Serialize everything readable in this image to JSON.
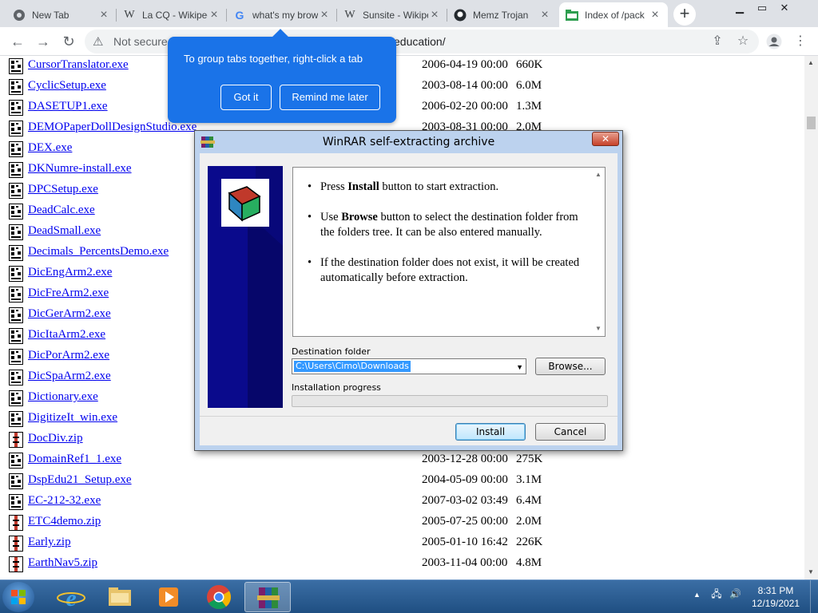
{
  "browser": {
    "tabs": [
      {
        "title": "New Tab",
        "icon": "chrome-icon"
      },
      {
        "title": "La CQ - Wikipedia",
        "icon": "wikipedia-icon"
      },
      {
        "title": "what's my browser",
        "icon": "google-icon"
      },
      {
        "title": "Sunsite - Wikipedia",
        "icon": "wikipedia-icon"
      },
      {
        "title": "Memz Trojan",
        "icon": "github-icon"
      },
      {
        "title": "Index of /pack",
        "icon": "folder-icon"
      }
    ],
    "not_secure_label": "Not secure",
    "url_tail": "education/"
  },
  "tooltip": {
    "message": "To group tabs together, right-click a tab",
    "got_it": "Got it",
    "remind_later": "Remind me later"
  },
  "listing": {
    "rows": [
      {
        "name": "CursorTranslator.exe",
        "date": "2006-04-19 00:00",
        "size": "660K",
        "type": "exe"
      },
      {
        "name": "CyclicSetup.exe",
        "date": "2003-08-14 00:00",
        "size": "6.0M",
        "type": "exe"
      },
      {
        "name": "DASETUP1.exe",
        "date": "2006-02-20 00:00",
        "size": "1.3M",
        "type": "exe"
      },
      {
        "name": "DEMOPaperDollDesignStudio.exe",
        "date": "2003-08-31 00:00",
        "size": "2.0M",
        "type": "exe"
      },
      {
        "name": "DEX.exe",
        "date": "",
        "size": "",
        "type": "exe"
      },
      {
        "name": "DKNumre-install.exe",
        "date": "",
        "size": "",
        "type": "exe"
      },
      {
        "name": "DPCSetup.exe",
        "date": "",
        "size": "",
        "type": "exe"
      },
      {
        "name": "DeadCalc.exe",
        "date": "",
        "size": "",
        "type": "exe"
      },
      {
        "name": "DeadSmall.exe",
        "date": "",
        "size": "",
        "type": "exe"
      },
      {
        "name": "Decimals_PercentsDemo.exe",
        "date": "",
        "size": "",
        "type": "exe"
      },
      {
        "name": "DicEngArm2.exe",
        "date": "",
        "size": "",
        "type": "exe"
      },
      {
        "name": "DicFreArm2.exe",
        "date": "",
        "size": "",
        "type": "exe"
      },
      {
        "name": "DicGerArm2.exe",
        "date": "",
        "size": "",
        "type": "exe"
      },
      {
        "name": "DicItaArm2.exe",
        "date": "",
        "size": "",
        "type": "exe"
      },
      {
        "name": "DicPorArm2.exe",
        "date": "",
        "size": "",
        "type": "exe"
      },
      {
        "name": "DicSpaArm2.exe",
        "date": "",
        "size": "",
        "type": "exe"
      },
      {
        "name": "Dictionary.exe",
        "date": "",
        "size": "",
        "type": "exe"
      },
      {
        "name": "DigitizeIt_win.exe",
        "date": "",
        "size": "",
        "type": "exe"
      },
      {
        "name": "DocDiv.zip",
        "date": "",
        "size": "",
        "type": "zip"
      },
      {
        "name": "DomainRef1_1.exe",
        "date": "2003-12-28 00:00",
        "size": "275K",
        "type": "exe"
      },
      {
        "name": "DspEdu21_Setup.exe",
        "date": "2004-05-09 00:00",
        "size": "3.1M",
        "type": "exe"
      },
      {
        "name": "EC-212-32.exe",
        "date": "2007-03-02 03:49",
        "size": "6.4M",
        "type": "exe"
      },
      {
        "name": "ETC4demo.zip",
        "date": "2005-07-25 00:00",
        "size": "2.0M",
        "type": "zip"
      },
      {
        "name": "Early.zip",
        "date": "2005-01-10 16:42",
        "size": "226K",
        "type": "zip"
      },
      {
        "name": "EarthNav5.zip",
        "date": "2003-11-04 00:00",
        "size": "4.8M",
        "type": "zip"
      }
    ]
  },
  "dialog": {
    "title": "WinRAR self-extracting archive",
    "bullets": [
      {
        "pre": "Press ",
        "bold": "Install",
        "post": " button to start extraction."
      },
      {
        "pre": "Use ",
        "bold": "Browse",
        "post": " button to select the destination folder from the folders tree. It can be also entered manually."
      },
      {
        "pre": "If the destination folder does not exist, it will be created automatically before extraction.",
        "bold": "",
        "post": ""
      }
    ],
    "destination_label": "Destination folder",
    "destination_value": "C:\\Users\\Cimo\\Downloads",
    "browse_label": "Browse...",
    "progress_label": "Installation progress",
    "progress": 0,
    "install_label": "Install",
    "cancel_label": "Cancel"
  },
  "taskbar": {
    "time": "8:31 PM",
    "date": "12/19/2021"
  }
}
